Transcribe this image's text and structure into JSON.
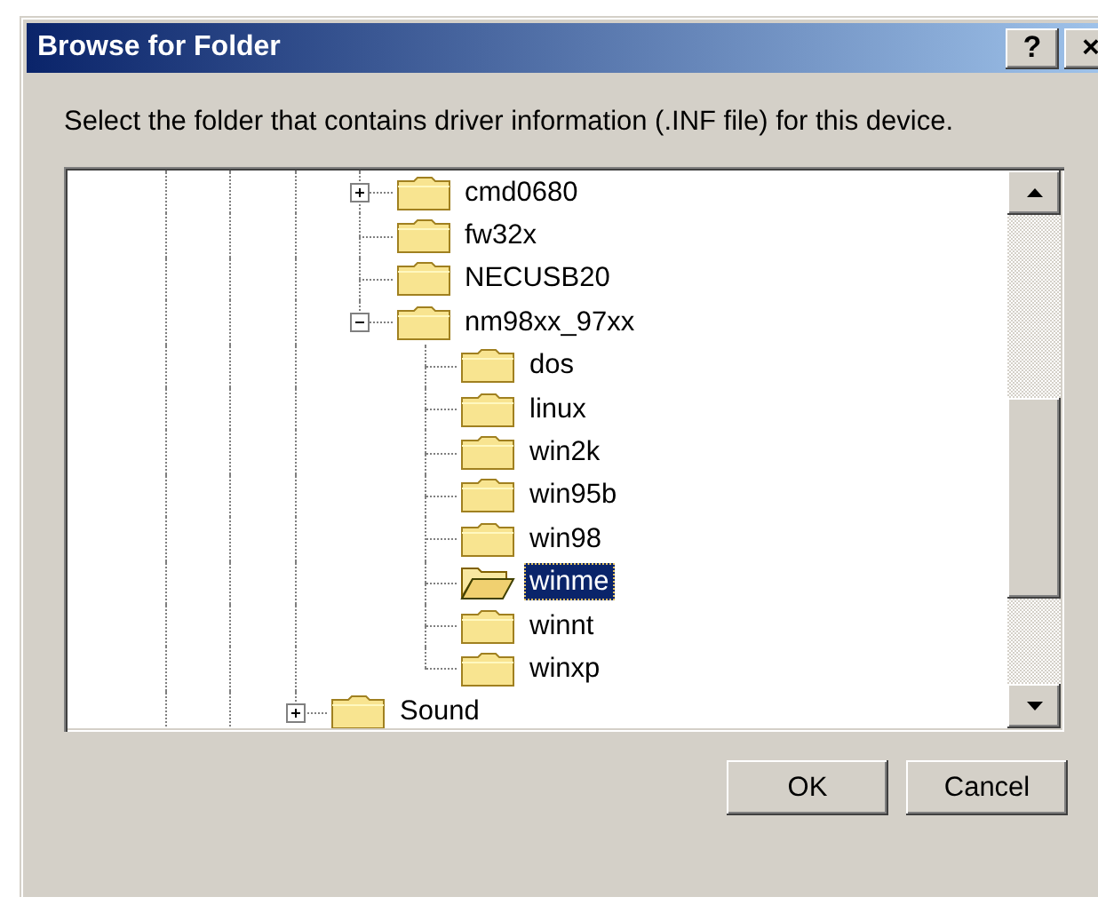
{
  "window": {
    "title": "Browse for Folder",
    "title_buttons": [
      "?",
      "×"
    ]
  },
  "prompt": "Select the folder that contains driver information (.INF file) for this device.",
  "tree": {
    "items": [
      {
        "children": [
          {
            "children": [
              {
                "children": [
                  {
                    "label": "cmd0680",
                    "selected": false,
                    "expanded": false
                  },
                  {
                    "label": "fw32x",
                    "selected": false
                  },
                  {
                    "label": "NECUSB20",
                    "selected": false
                  },
                  {
                    "label": "nm98xx_97xx",
                    "selected": false,
                    "expanded": true,
                    "children": [
                      {
                        "label": "dos",
                        "selected": false
                      },
                      {
                        "label": "linux",
                        "selected": false
                      },
                      {
                        "label": "win2k",
                        "selected": false
                      },
                      {
                        "label": "win95b",
                        "selected": false
                      },
                      {
                        "label": "win98",
                        "selected": false
                      },
                      {
                        "label": "winme",
                        "selected": true
                      },
                      {
                        "label": "winnt",
                        "selected": false
                      },
                      {
                        "label": "winxp",
                        "selected": false
                      }
                    ]
                  }
                ]
              },
              {
                "label": "Sound",
                "selected": false,
                "expanded": false
              }
            ]
          }
        ]
      }
    ]
  },
  "buttons": [
    "OK",
    "Cancel"
  ]
}
